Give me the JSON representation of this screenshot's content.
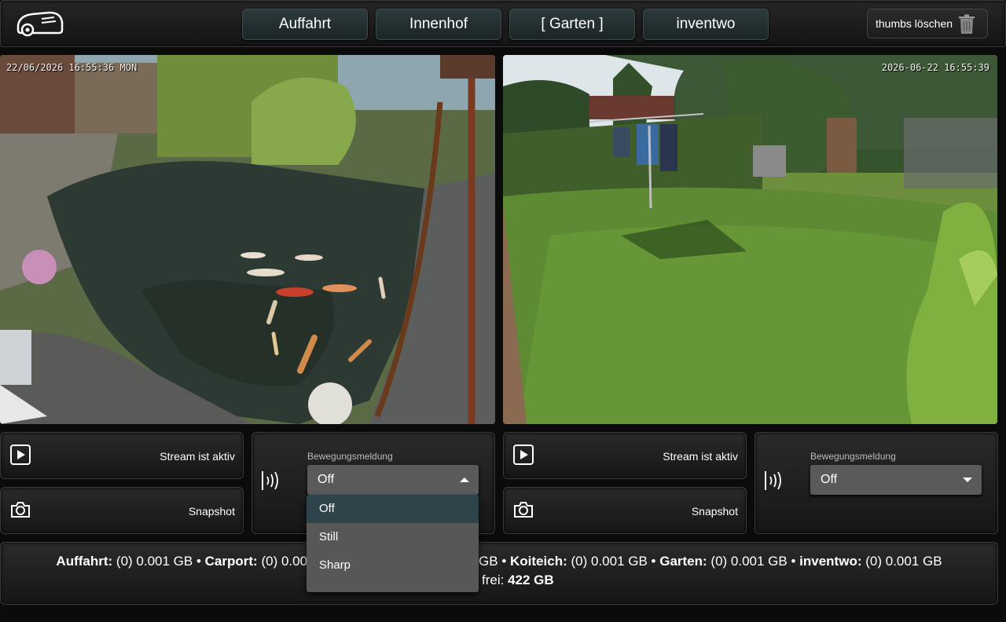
{
  "nav": {
    "buttons": [
      "Auffahrt",
      "Innenhof",
      "[ Garten ]",
      "inventwo"
    ],
    "delete_label": "thumbs löschen"
  },
  "cams": [
    {
      "timestamp": "22/06/2026 16:55:36 MON"
    },
    {
      "timestamp": "2026-06-22 16:55:39"
    }
  ],
  "controls": {
    "stream_label": "Stream ist aktiv",
    "snapshot_label": "Snapshot",
    "motion_caption": "Bewegungsmeldung",
    "motion_value_left": "Off",
    "motion_value_right": "Off",
    "motion_options": [
      "Off",
      "Still",
      "Sharp"
    ]
  },
  "status": {
    "line1": [
      {
        "name": "Auffahrt:",
        "value": "(0) 0.001 GB"
      },
      {
        "name": "Carport:",
        "value": "(0) 0.00"
      },
      {
        "name": "",
        "value": "GB"
      },
      {
        "name": "Koiteich:",
        "value": "(0) 0.001 GB"
      },
      {
        "name": "Garten:",
        "value": "(0) 0.001 GB"
      },
      {
        "name": "inventwo:",
        "value": "(0) 0.001 GB"
      }
    ],
    "line2_label": "frei:",
    "line2_value": "422 GB"
  },
  "colors": {
    "accent": "#2e434a",
    "nav_button": "#2c3a3d",
    "select_bg": "#5a5a5a"
  }
}
